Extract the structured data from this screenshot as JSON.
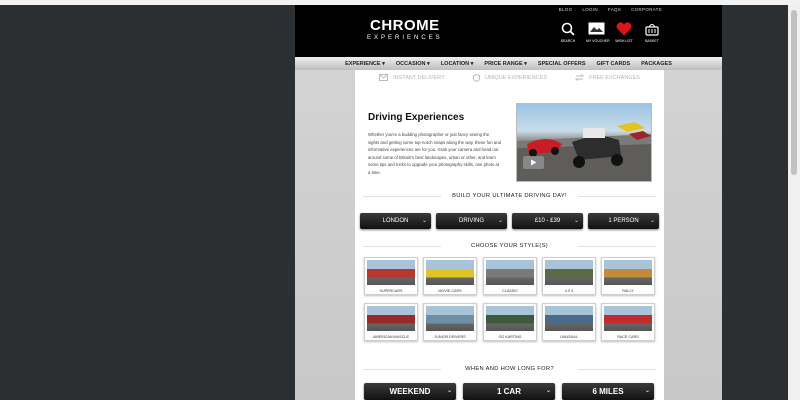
{
  "header": {
    "util_links": [
      "BLOG",
      "LOGIN",
      "FAQS",
      "CORPORATE"
    ],
    "logo_line1": "CHROME",
    "logo_line2": "EXPERIENCES",
    "icons": [
      {
        "name": "search-icon",
        "label": "SEARCH"
      },
      {
        "name": "voucher-icon",
        "label": "MY VOUCHER"
      },
      {
        "name": "heart-icon",
        "label": "WISH LIST"
      },
      {
        "name": "basket-icon",
        "label": "BASKET"
      }
    ]
  },
  "nav": [
    "EXPERIENCE",
    "OCCASION",
    "LOCATION",
    "PRICE RANGE",
    "SPECIAL OFFERS",
    "GIFT CARDS",
    "PACKAGES"
  ],
  "usps": [
    {
      "icon": "envelope-icon",
      "label": "INSTANT DELIVERY"
    },
    {
      "icon": "shield-icon",
      "label": "UNIQUE EXPERIENCES"
    },
    {
      "icon": "exchange-icon",
      "label": "FREE EXCHANGES"
    }
  ],
  "intro": {
    "title": "Driving Experiences",
    "body": "Whether you're a budding photographer or just fancy seeing the sights and getting some top-notch snaps along the way, these fun and informative experiences are for you. Grab your camera and head out around some of Britain's best landscapes, urban or other, and learn some tips and tricks to upgrade your photography skills, one photo at a time."
  },
  "build": {
    "title": "BUILD YOUR ULTIMATE DRIVING DAY!",
    "dropdowns": [
      "LONDON",
      "DRIVING",
      "£10 - £39",
      "1 PERSON"
    ]
  },
  "styles": {
    "title": "CHOOSE YOUR STYLE(S)",
    "tiles": [
      "SUPERCARS",
      "MOVIE CARS",
      "CLASSIC",
      "4 X 4",
      "RALLY",
      "AMERICAN MUSCLE",
      "JUNIOR DRIVERS",
      "GO KARTING",
      "UNUSUAL",
      "RACE CARS"
    ],
    "tile_colors": [
      "#b8362d",
      "#e0c424",
      "#7a7a78",
      "#5b6b44",
      "#c38a3a",
      "#9a2a2a",
      "#6f8fa7",
      "#3d5a3a",
      "#4a6a8a",
      "#c42b2b"
    ]
  },
  "when": {
    "title": "WHEN AND HOW LONG FOR?",
    "dropdowns": [
      "WEEKEND",
      "1 CAR",
      "6 MILES"
    ]
  }
}
